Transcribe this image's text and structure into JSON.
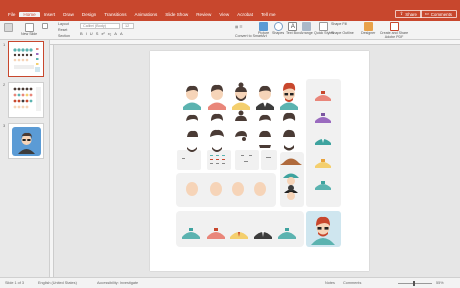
{
  "menu": [
    "File",
    "Home",
    "Insert",
    "Draw",
    "Design",
    "Transitions",
    "Animations",
    "Slide Show",
    "Review",
    "View",
    "Acrobat",
    "Tell me"
  ],
  "menu_active_index": 1,
  "header": {
    "share": "Share",
    "comments": "Comments"
  },
  "ribbon": {
    "new_slide": "New Slide",
    "layout": "Layout",
    "reset": "Reset",
    "section": "Section",
    "font_placeholder": "Calibri (Body)",
    "font_size": "12",
    "convert_to_smartart": "Convert to SmartArt",
    "picture": "Picture",
    "shapes": "Shapes",
    "text_box": "Text Box",
    "arrange": "Arrange",
    "quick_styles": "Quick Styles",
    "shape_fill": "Shape Fill",
    "shape_outline": "Shape Outline",
    "designer": "Designer",
    "create_share": "Create and Share Adobe PDF",
    "format_buttons": [
      "B",
      "I",
      "U",
      "S",
      "x²",
      "x₂",
      "A",
      "A"
    ]
  },
  "thumbnails": [
    {
      "num": "1",
      "selected": true
    },
    {
      "num": "2",
      "selected": false
    },
    {
      "num": "3",
      "selected": false
    }
  ],
  "status": {
    "slide_of": "Slide 1 of 3",
    "language": "English (United States)",
    "accessibility": "Accessibility: Investigate",
    "notes": "Notes",
    "comments": "Comments",
    "zoom": "55%"
  },
  "colors": {
    "accent": "#c8472d",
    "skin": "#f6d4b8",
    "teal": "#5bb3b0",
    "salmon": "#e9867a",
    "yellow": "#f4cf6e",
    "dark": "#3c3c3c",
    "hair": "#4a3b35",
    "avatar_bg": "#cfe6ef"
  }
}
